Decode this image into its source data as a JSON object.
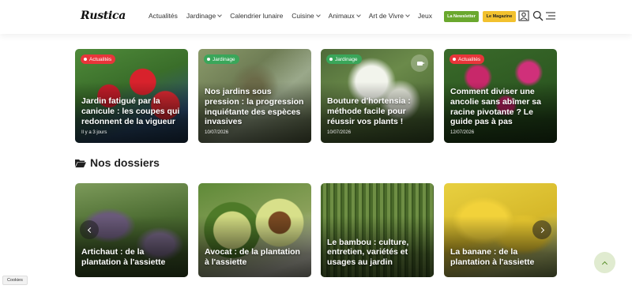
{
  "header": {
    "logo": "Rustica",
    "nav": [
      "Actualités",
      "Jardinage",
      "Calendrier lunaire",
      "Cuisine",
      "Animaux",
      "Art de Vivre",
      "Jeux"
    ],
    "nav_has_dropdown": [
      false,
      true,
      false,
      true,
      true,
      true,
      false
    ],
    "newsletter_label": "La Newsletter",
    "magazine_label": "Le Magazine"
  },
  "articles": [
    {
      "badge": "Actualités",
      "badge_color": "#e8353a",
      "title": "Jardin fatigué par la canicule : les coupes qui redonnent de la vigueur",
      "date": "Il y a 3 jours"
    },
    {
      "badge": "Jardinage",
      "badge_color": "#3aa65a",
      "title": "Nos jardins sous pression : la progression inquiétante des espèces invasives",
      "date": "10/07/2026"
    },
    {
      "badge": "Jardinage",
      "badge_color": "#3aa65a",
      "title": "Bouture d'hortensia : méthode facile pour réussir vos plants !",
      "date": "10/07/2026",
      "video_icon": "video-camera-icon"
    },
    {
      "badge": "Actualités",
      "badge_color": "#e8353a",
      "title": "Comment diviser une ancolie sans abîmer sa racine pivotante ? Le guide pas à pas",
      "date": "12/07/2026"
    }
  ],
  "dossiers": {
    "title": "Nos dossiers",
    "items": [
      {
        "title": "Artichaut : de la plantation à l'assiette"
      },
      {
        "title": "Avocat : de la plantation à l'assiette"
      },
      {
        "title": "Le bambou : culture, entretien, variétés et usages au jardin"
      },
      {
        "title": "La banane : de la plantation à l'assiette"
      }
    ]
  },
  "cookies_label": "Cookies",
  "colors": {
    "green": "#6aa82e",
    "yellow": "#f2c12e",
    "red_badge": "#e8353a",
    "green_badge": "#3aa65a"
  }
}
